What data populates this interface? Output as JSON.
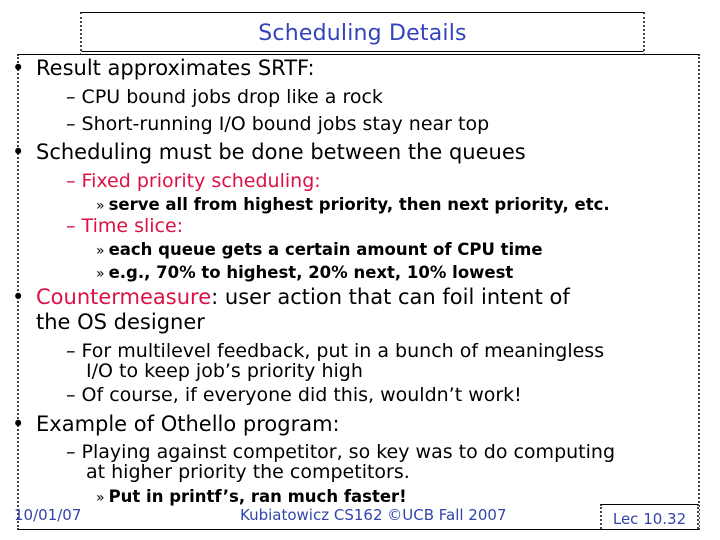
{
  "slide": {
    "title": "Scheduling Details",
    "bullets": [
      {
        "text": "Result approximates SRTF:",
        "subs": [
          {
            "text": "CPU bound jobs drop like a rock"
          },
          {
            "text": "Short-running I/O bound jobs stay near top"
          }
        ]
      },
      {
        "text": "Scheduling must be done between the queues",
        "subs": [
          {
            "text": "Fixed priority scheduling:",
            "items": [
              "serve all from highest priority, then next priority, etc."
            ]
          },
          {
            "text": "Time slice:",
            "items": [
              "each queue gets a certain amount of CPU time",
              "e.g., 70% to highest, 20% next, 10% lowest"
            ]
          }
        ]
      },
      {
        "highlight": "Countermeasure",
        "text_line1": ": user action that can foil intent of",
        "text_line2": "the OS designer",
        "subs": [
          {
            "line1": "For multilevel feedback, put in a bunch of meaningless",
            "line2": "I/O to keep job’s priority high"
          },
          {
            "text": "Of course, if everyone did this, wouldn’t work!"
          }
        ]
      },
      {
        "text": "Example of Othello program:",
        "subs": [
          {
            "line1": "Playing against competitor, so key was to do computing",
            "line2": "at higher priority the competitors.",
            "items": [
              "Put in printf’s, ran much faster!"
            ]
          }
        ]
      }
    ],
    "bullet_glyph": "•",
    "dash_glyph": "–",
    "sub_glyph": "»"
  },
  "footer": {
    "date": "10/01/07",
    "center": "Kubiatowicz CS162 ©UCB Fall 2007",
    "lecture": "Lec 10.32"
  },
  "colors": {
    "title": "#3344bb",
    "highlight": "#dd1144",
    "footer": "#3344aa"
  }
}
